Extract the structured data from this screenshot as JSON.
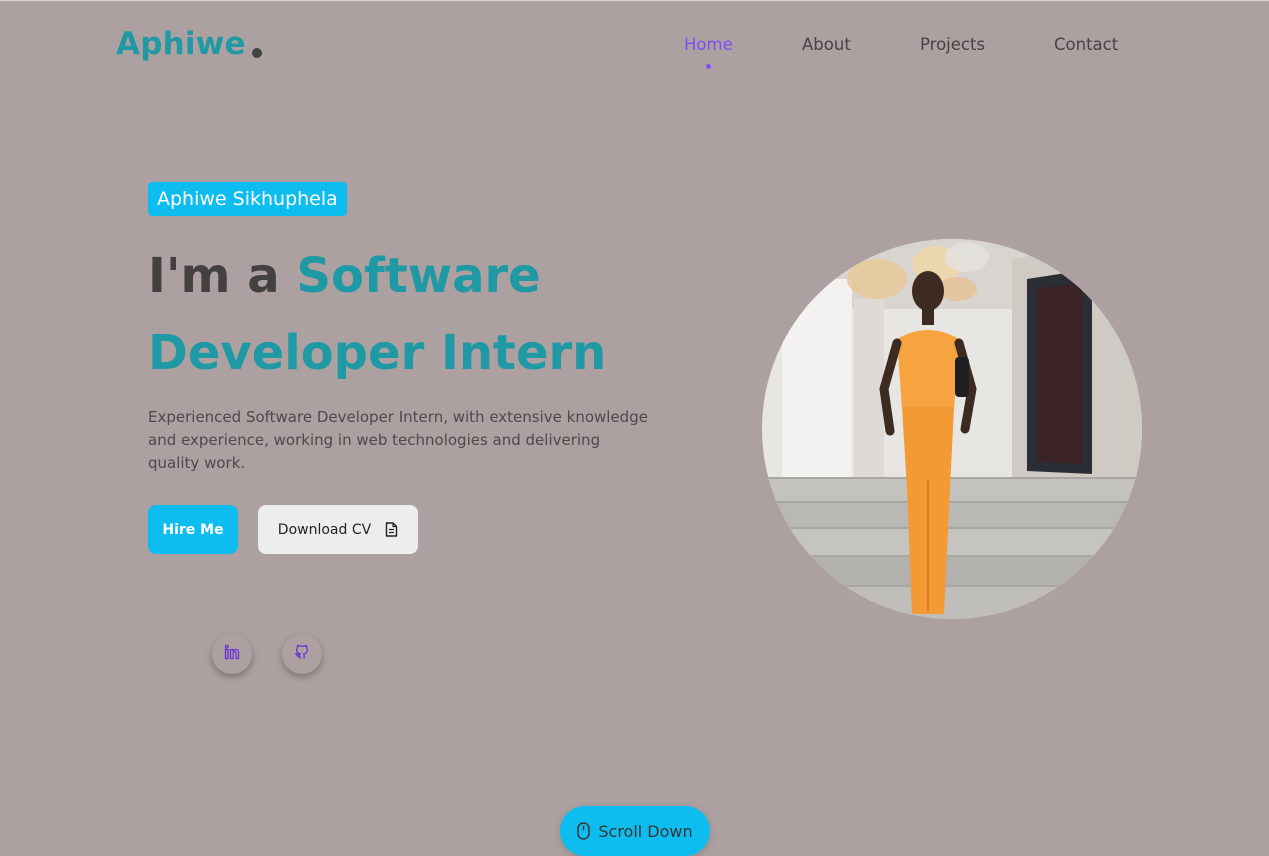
{
  "header": {
    "logo_text": "Aphiwe",
    "nav": [
      {
        "label": "Home",
        "active": true
      },
      {
        "label": "About",
        "active": false
      },
      {
        "label": "Projects",
        "active": false
      },
      {
        "label": "Contact",
        "active": false
      }
    ]
  },
  "hero": {
    "name_badge": "Aphiwe Sikhuphela",
    "headline_prefix": "I'm a ",
    "headline_highlight_1": "Software",
    "headline_highlight_2": "Developer Intern",
    "description": "Experienced Software Developer Intern, with extensive knowledge and experience, working in web technologies and delivering quality work.",
    "hire_button": "Hire Me",
    "cv_button": "Download CV",
    "cv_icon": "document-icon",
    "social": [
      {
        "name": "linkedin-icon"
      },
      {
        "name": "github-icon"
      }
    ],
    "photo_alt": "Aphiwe Sikhuphela portrait"
  },
  "scroll": {
    "label": "Scroll Down",
    "icon": "mouse-icon"
  },
  "colors": {
    "background": "#aca0a0",
    "accent_teal": "#1f9aa5",
    "accent_cyan": "#0dbdf0",
    "nav_active": "#7b4ff5",
    "text_dark": "#454040"
  }
}
